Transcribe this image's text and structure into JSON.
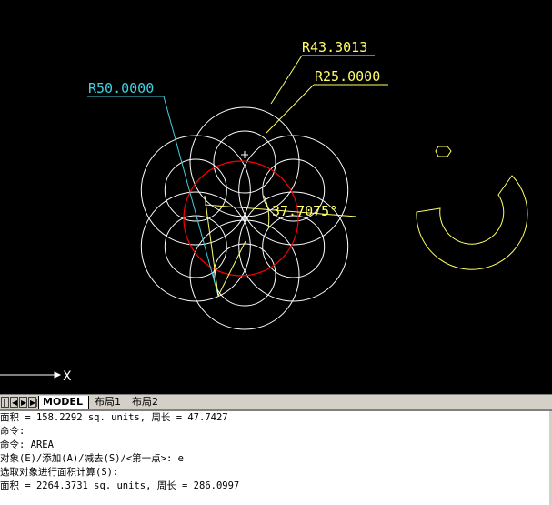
{
  "drawing": {
    "dimension_r50": "R50.0000",
    "dimension_r43": "R43.3013",
    "dimension_r25": "R25.0000",
    "angle_dimension": "37.7075°",
    "ucs_axis_label": "X",
    "colors": {
      "background": "#000000",
      "geometry": "#ffffff",
      "dimension_yellow": "#ffff66",
      "dimension_cyan": "#40d0e0",
      "red_circle": "#ff0000"
    }
  },
  "tabs": {
    "model": "MODEL",
    "layout1": "布局1",
    "layout2": "布局2"
  },
  "command_history": [
    "面积 = 158.2292 sq. units, 周长 = 47.7427",
    "命令:",
    "命令: AREA",
    "对象(E)/添加(A)/减去(S)/<第一点>: e",
    "选取对象进行面积计算(S):",
    "面积 = 2264.3731 sq. units, 周长 = 286.0997"
  ]
}
